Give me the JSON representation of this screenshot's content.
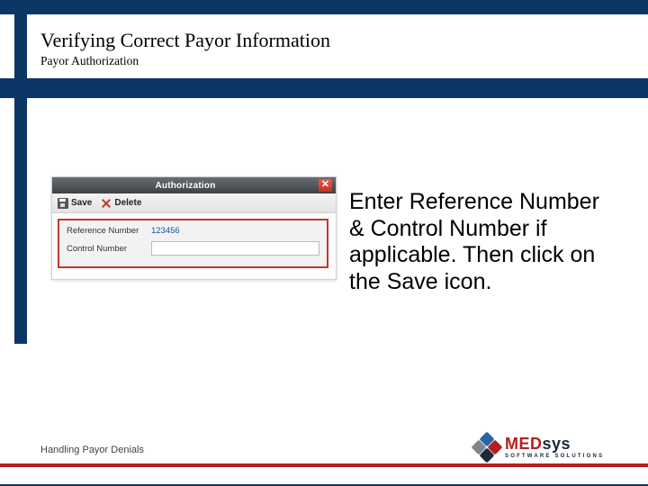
{
  "header": {
    "title": "Verifying Correct Payor Information",
    "subtitle": "Payor Authorization"
  },
  "mock": {
    "window_title": "Authorization",
    "close_glyph": "✕",
    "toolbar": {
      "save_label": "Save",
      "delete_label": "Delete"
    },
    "form": {
      "reference_label": "Reference Number",
      "reference_value": "123456",
      "control_label": "Control Number",
      "control_value": ""
    }
  },
  "instruction": "Enter Reference Number & Control Number if applicable. Then click on the Save icon.",
  "footer": {
    "label": "Handling Payor Denials",
    "logo_main_med": "MED",
    "logo_main_sys": "sys",
    "logo_sub": "SOFTWARE SOLUTIONS"
  }
}
